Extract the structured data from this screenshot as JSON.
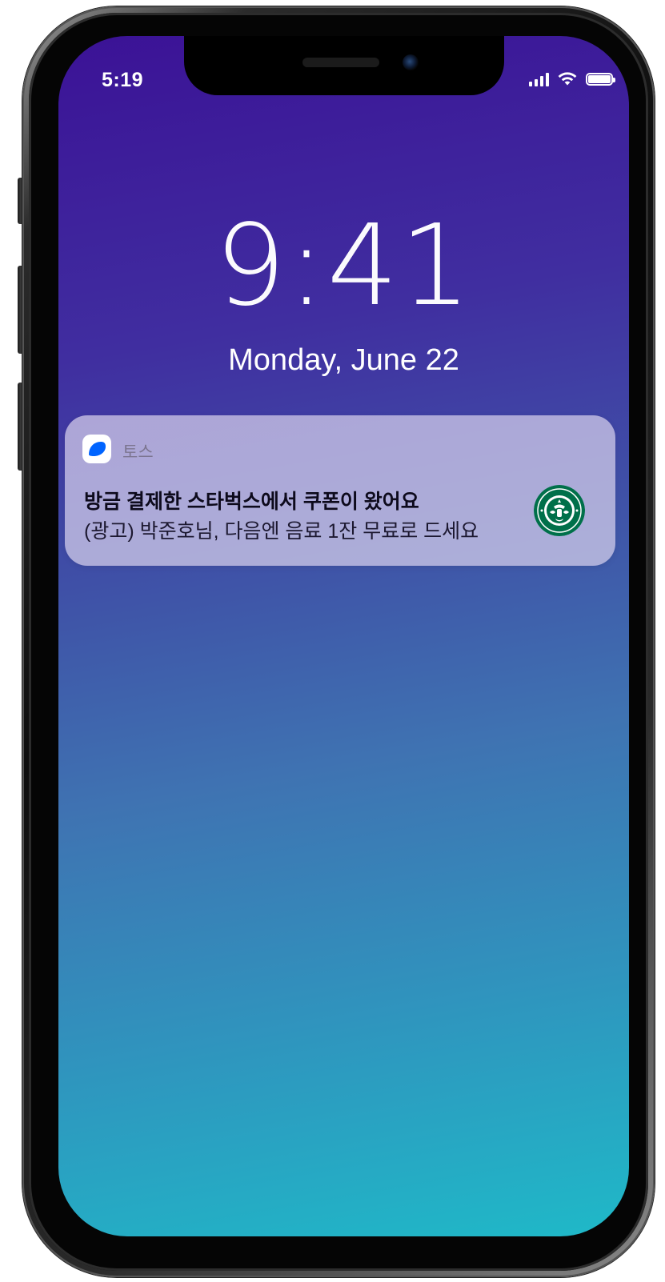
{
  "status_bar": {
    "time": "5:19",
    "signal_bars": 4,
    "battery_level": 1.0
  },
  "lock_screen": {
    "time": "9:41",
    "date": "Monday, June 22"
  },
  "notification": {
    "app_name": "토스",
    "title": "방금 결제한 스타벅스에서 쿠폰이 왔어요",
    "body": "(광고) 박준호님, 다음엔 음료 1잔 무료로 드세요",
    "app_icon": "toss-app-icon",
    "thumbnail_icon": "starbucks-logo-icon"
  },
  "colors": {
    "wallpaper_top": "#3b1296",
    "wallpaper_bottom": "#1fb9c8",
    "toss_blue": "#0064ff",
    "starbucks_green": "#00704a"
  }
}
